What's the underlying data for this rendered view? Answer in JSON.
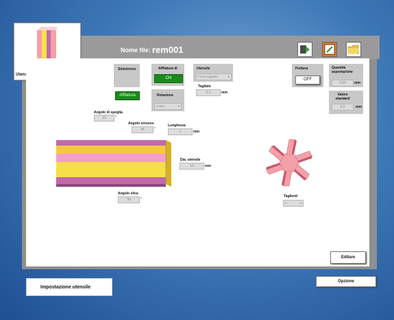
{
  "header": {
    "nome_file_label": "Nome file:",
    "nome_file_value": "rem001"
  },
  "tool_panel": {
    "label": "Utensile selezionato"
  },
  "section1": {
    "sinistrorso_label": "Sinistrorso",
    "affilatura_button": "Affilatura",
    "affilatura_di_label": "Affilatura di",
    "on_button": "ON",
    "rotazione_label": "Rotazione",
    "rotazione_value": "Orario",
    "utensile_label": "Utensile",
    "utensile_value": "Fresa raggiata",
    "tagliato_label": "Tagliato",
    "tagliato_value": "0.1",
    "tagliato_unit": "mm"
  },
  "finitura": {
    "label": "Finitura",
    "value": "OFF"
  },
  "quantita": {
    "label": "Quantità asportazione",
    "value": "0.20",
    "unit": "mm"
  },
  "valore_standard": {
    "label": "Valore standard",
    "value": "0.2",
    "unit": "mm"
  },
  "params": {
    "angolo_spoglia_label": "Angolo di spoglia",
    "angolo_spoglia_value": "10",
    "angolo_spoglia_unit": "°",
    "angolo_smusso_label": "Angolo smusso",
    "angolo_smusso_value": "45",
    "angolo_smusso_unit": "°",
    "lunghezza_label": "Lunghezza",
    "lunghezza_value": "1",
    "lunghezza_unit": "mm",
    "dia_label": "Dia. utensile",
    "dia_value": "10",
    "dia_unit": "mm",
    "angolo_elica_label": "Angolo elica",
    "angolo_elica_value": "30",
    "angolo_elica_unit": "°",
    "taglienti_label": "Taglienti",
    "taglienti_value": "6"
  },
  "buttons": {
    "editare": "Editare",
    "opzione": "Opzione",
    "impostazione": "Impostazione utensile"
  },
  "colors": {
    "accent_green": "#1c8a1c",
    "tool_pink": "#f4a0a8",
    "tool_yellow": "#f5e04a",
    "tool_magenta": "#c06aa8"
  }
}
